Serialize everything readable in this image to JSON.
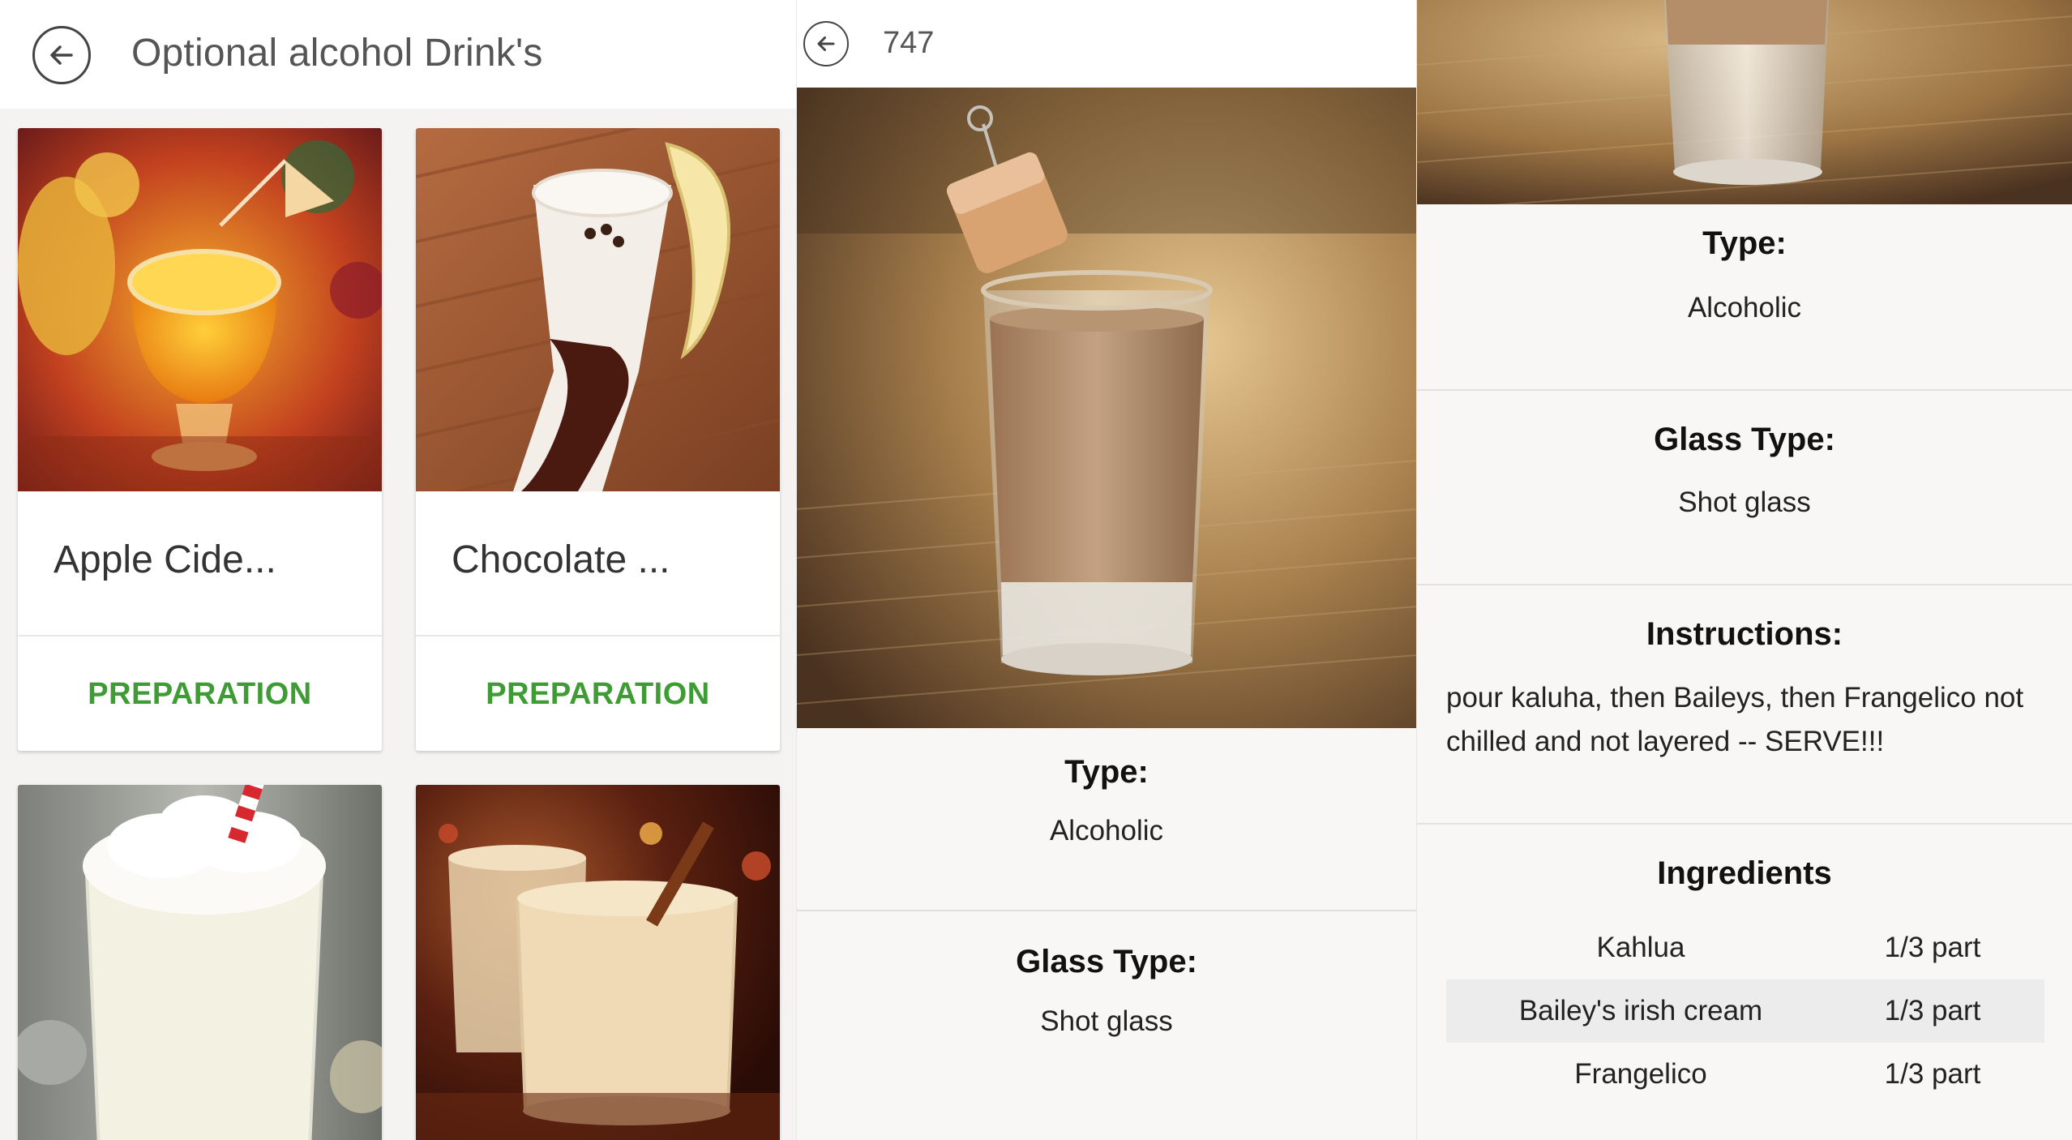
{
  "list_screen": {
    "title": "Optional alcohol Drink's",
    "cards": [
      {
        "name": "Apple Cide...",
        "action": "PREPARATION",
        "image": "orange-punch-photo"
      },
      {
        "name": "Chocolate ...",
        "action": "PREPARATION",
        "image": "chocolate-banana-shake-photo"
      },
      {
        "name": "",
        "action": "",
        "image": "whipped-cream-drink-photo"
      },
      {
        "name": "",
        "action": "",
        "image": "eggnog-cinnamon-photo"
      }
    ]
  },
  "detail_screen": {
    "title": "747",
    "photo": "layered-shot-photo",
    "type_label": "Type:",
    "type_value": "Alcoholic",
    "glass_label": "Glass Type:",
    "glass_value": "Shot glass"
  },
  "detail_scrolled": {
    "photo": "layered-shot-photo",
    "type_label": "Type:",
    "type_value": "Alcoholic",
    "glass_label": "Glass Type:",
    "glass_value": "Shot glass",
    "instructions_label": "Instructions:",
    "instructions_text": "pour kaluha, then Baileys, then Frangelico not chilled and not layered -- SERVE!!!",
    "ingredients_label": "Ingredients",
    "ingredients": [
      {
        "name": "Kahlua",
        "measure": "1/3 part"
      },
      {
        "name": "Bailey's irish cream",
        "measure": "1/3 part"
      },
      {
        "name": "Frangelico",
        "measure": "1/3 part"
      }
    ]
  },
  "colors": {
    "accent_green": "#3f9c35",
    "background": "#f8f7f5",
    "header_text": "#555555"
  }
}
